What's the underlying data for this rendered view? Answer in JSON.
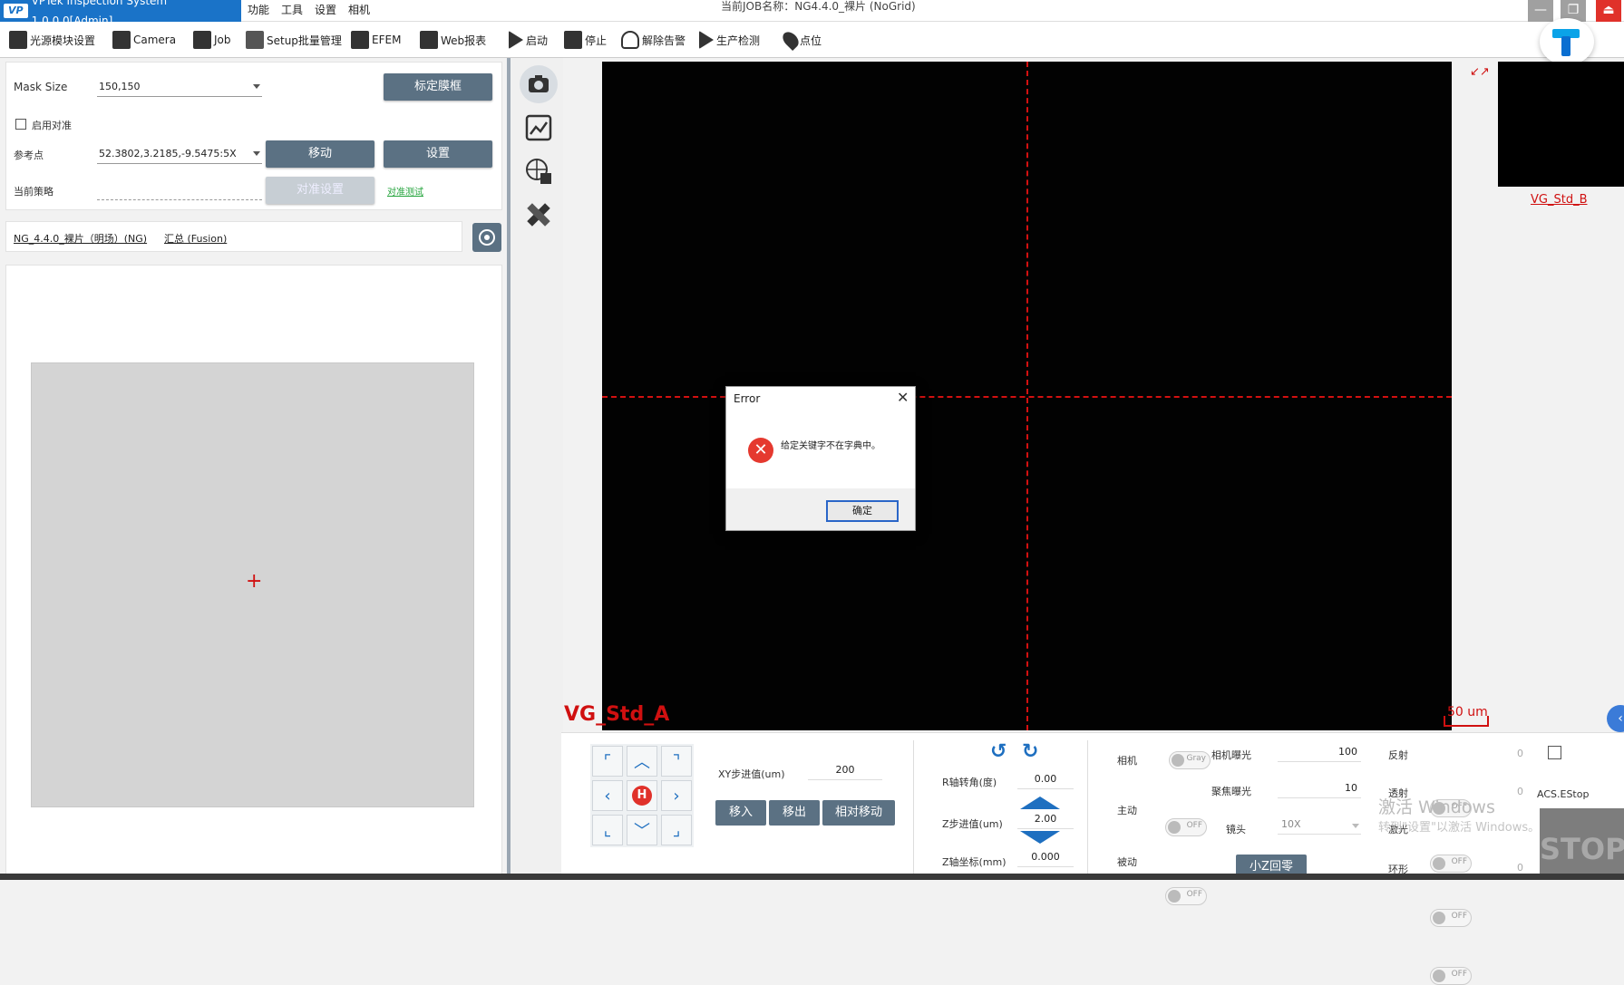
{
  "window": {
    "app_title": "VPTek Inspection System 1.0.0.0[Admin]",
    "logo": "VP",
    "menus": [
      "功能",
      "工具",
      "设置",
      "相机"
    ],
    "job_title": "当前JOB名称：NG4.4.0_裸片 (NoGrid)",
    "minimize": "—",
    "maximize": "❐",
    "exit": "⏏"
  },
  "toolbar": {
    "items": [
      {
        "label": "光源模块设置",
        "icon": "light-tools-icon"
      },
      {
        "label": "Camera",
        "icon": "camera-icon"
      },
      {
        "label": "Job",
        "icon": "briefcase-icon"
      },
      {
        "label": "Setup批量管理",
        "icon": "checklist-icon"
      },
      {
        "label": "EFEM",
        "icon": "robot-arm-icon"
      },
      {
        "label": "Web报表",
        "icon": "web-report-icon"
      },
      {
        "label": "启动",
        "icon": "play-icon"
      },
      {
        "label": "停止",
        "icon": "stop-icon"
      },
      {
        "label": "解除告警",
        "icon": "bell-off-icon"
      },
      {
        "label": "生产检测",
        "icon": "play-icon"
      },
      {
        "label": "点位",
        "icon": "map-pin-icon"
      }
    ]
  },
  "settings": {
    "mask_size_label": "Mask Size",
    "mask_size_value": "150,150",
    "calibrate_button": "标定膜框",
    "enable_align_label": "启用对准",
    "ref_point_label": "参考点",
    "ref_point_value": "52.3802,3.2185,-9.5475:5X",
    "move_button": "移动",
    "set_button": "设置",
    "strategy_label": "当前策略",
    "strategy_value": "",
    "align_setup_button": "对准设置",
    "align_test_link": "对准测试"
  },
  "recipe": {
    "job_link": "NG_4.4.0_裸片（明场）(NG)",
    "fusion_link": "汇总 (Fusion)"
  },
  "preview": {
    "marker": "+"
  },
  "viewer": {
    "image_label": "VG_Std_A",
    "scale_label": "50 um",
    "thumb_label": "VG_Std_B",
    "expand_icon": "↙↗"
  },
  "dialog": {
    "title": "Error",
    "close": "✕",
    "icon_glyph": "✕",
    "message": "给定关键字不在字典中。",
    "ok_button": "确定"
  },
  "motion": {
    "home": "H",
    "xy_step_label": "XY步进值(um)",
    "xy_step_value": "200",
    "move_in": "移入",
    "move_out": "移出",
    "relative_move": "相对移动",
    "r_angle_label": "R轴转角(度)",
    "r_angle_value": "0.00",
    "z_step_label": "Z步进值(um)",
    "z_step_value": "2.00",
    "z_coord_label": "Z轴坐标(mm)",
    "z_coord_value": "0.000",
    "small_z_home": "小Z回零"
  },
  "camera_ctrl": {
    "camera_label": "相机",
    "camera_toggle": "Gray",
    "active_label": "主动",
    "active_toggle": "OFF",
    "passive_label": "被动",
    "passive_toggle": "OFF",
    "exposure_label": "相机曝光",
    "exposure_value": "100",
    "focus_exposure_label": "聚焦曝光",
    "focus_exposure_value": "10",
    "lens_label": "镜头",
    "lens_value": "10X"
  },
  "lights": {
    "reflect_label": "反射",
    "reflect_toggle": "OFF",
    "reflect_value": "0",
    "transmit_label": "透射",
    "transmit_toggle": "OFF",
    "transmit_value": "0",
    "laser_label": "激光",
    "laser_toggle": "OFF",
    "ring_label": "环形",
    "ring_toggle": "OFF",
    "ring_value": "0",
    "estop_label": "ACS.EStop",
    "stop_text": "STOP"
  },
  "os": {
    "watermark_title": "激活 Windows",
    "watermark_sub": "转到\"设置\"以激活 Windows。"
  }
}
